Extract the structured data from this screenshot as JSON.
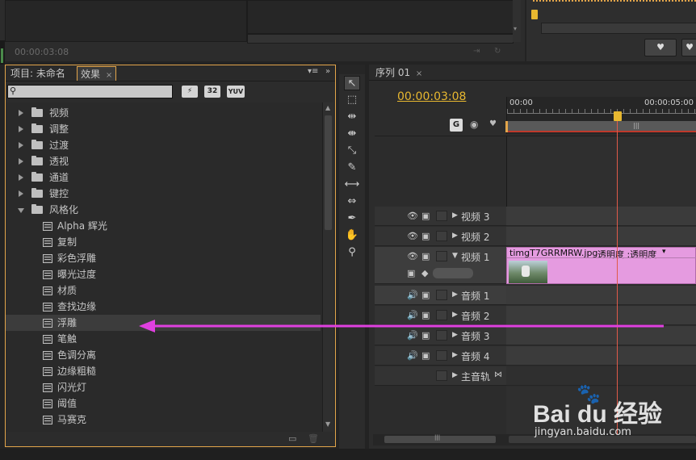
{
  "top": {
    "timecode": "00:00:03:08"
  },
  "effects_panel": {
    "tab_project": "项目: 未命名",
    "tab_effects": "效果",
    "close_glyph": "×",
    "menu_glyph": "▾≡",
    "search_placeholder": "",
    "filter_buttons": [
      "32",
      "YUV"
    ],
    "folders": [
      {
        "label": "视频"
      },
      {
        "label": "调整"
      },
      {
        "label": "过渡"
      },
      {
        "label": "透视"
      },
      {
        "label": "通道"
      },
      {
        "label": "键控"
      },
      {
        "label": "风格化"
      }
    ],
    "effects": [
      {
        "label": "Alpha 辉光"
      },
      {
        "label": "复制"
      },
      {
        "label": "彩色浮雕"
      },
      {
        "label": "曝光过度"
      },
      {
        "label": "材质"
      },
      {
        "label": "查找边缘"
      },
      {
        "label": "浮雕"
      },
      {
        "label": "笔触"
      },
      {
        "label": "色调分离"
      },
      {
        "label": "边缘粗糙"
      },
      {
        "label": "闪光灯"
      },
      {
        "label": "阈值"
      },
      {
        "label": "马赛克"
      }
    ],
    "selected_effect_index": 6
  },
  "timeline": {
    "tab_label": "序列 01",
    "close_glyph": "×",
    "timecode": "00:00:03:08",
    "ruler_start": "00:00",
    "ruler_end": "00:00:05:00",
    "clip_name": "timgT7GRRMRW.jpg",
    "clip_effect": "透明度 :透明度",
    "video_tracks": [
      {
        "name": "视频 3"
      },
      {
        "name": "视频 2"
      },
      {
        "name": "视频 1"
      }
    ],
    "audio_tracks": [
      {
        "name": "音频 1"
      },
      {
        "name": "音频 2"
      },
      {
        "name": "音频 3"
      },
      {
        "name": "音频 4"
      }
    ],
    "master_track": "主音轨"
  },
  "watermark": {
    "brand": "Bai du 经验",
    "url": "jingyan.baidu.com"
  },
  "colors": {
    "accent_orange": "#e3a54a",
    "timecode_yellow": "#e8b830",
    "playhead": "#e05a4a",
    "clip_pink": "#e59be0",
    "annotation_arrow": "#e040e0"
  }
}
